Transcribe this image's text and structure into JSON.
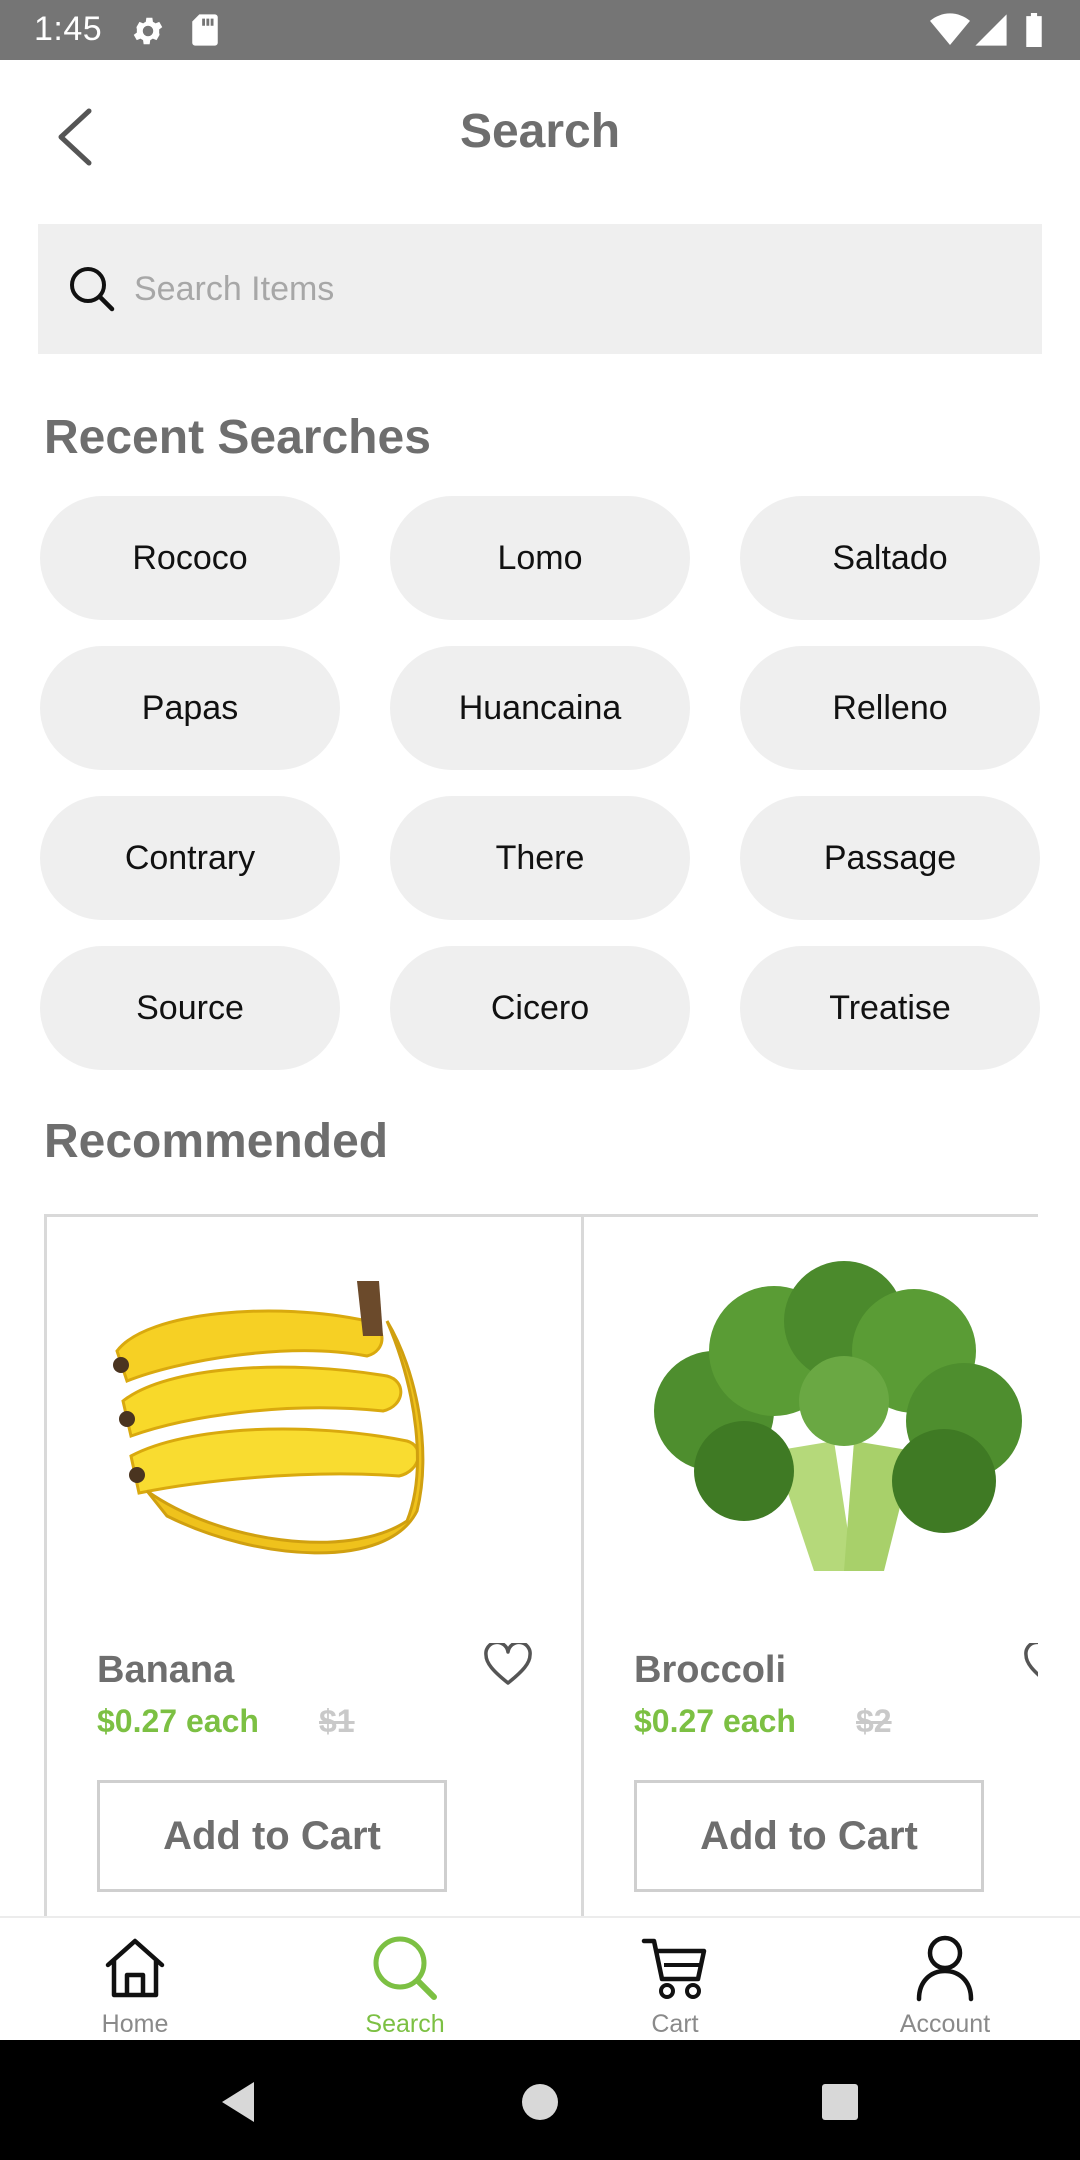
{
  "status_bar": {
    "time": "1:45"
  },
  "header": {
    "title": "Search"
  },
  "search": {
    "placeholder": "Search Items"
  },
  "recent": {
    "title": "Recent Searches",
    "items": [
      "Rococo",
      "Lomo",
      "Saltado",
      "Papas",
      "Huancaina",
      "Relleno",
      "Contrary",
      "There",
      "Passage",
      "Source",
      "Cicero",
      "Treatise"
    ]
  },
  "recommended": {
    "title": "Recommended",
    "items": [
      {
        "name": "Banana",
        "price": "$0.27 each",
        "old_price": "$1",
        "button": "Add to Cart",
        "image": "banana-bunch"
      },
      {
        "name": "Broccoli",
        "price": "$0.27 each",
        "old_price": "$2",
        "button": "Add to Cart",
        "image": "broccoli"
      }
    ]
  },
  "nav": {
    "items": [
      {
        "label": "Home",
        "icon": "home-icon",
        "active": false
      },
      {
        "label": "Search",
        "icon": "search-icon",
        "active": true
      },
      {
        "label": "Cart",
        "icon": "cart-icon",
        "active": false
      },
      {
        "label": "Account",
        "icon": "account-icon",
        "active": false
      }
    ]
  },
  "colors": {
    "accent": "#7cc043",
    "chip_bg": "#efefef",
    "muted_text": "#6e6e6e",
    "status_bar": "#757575"
  }
}
